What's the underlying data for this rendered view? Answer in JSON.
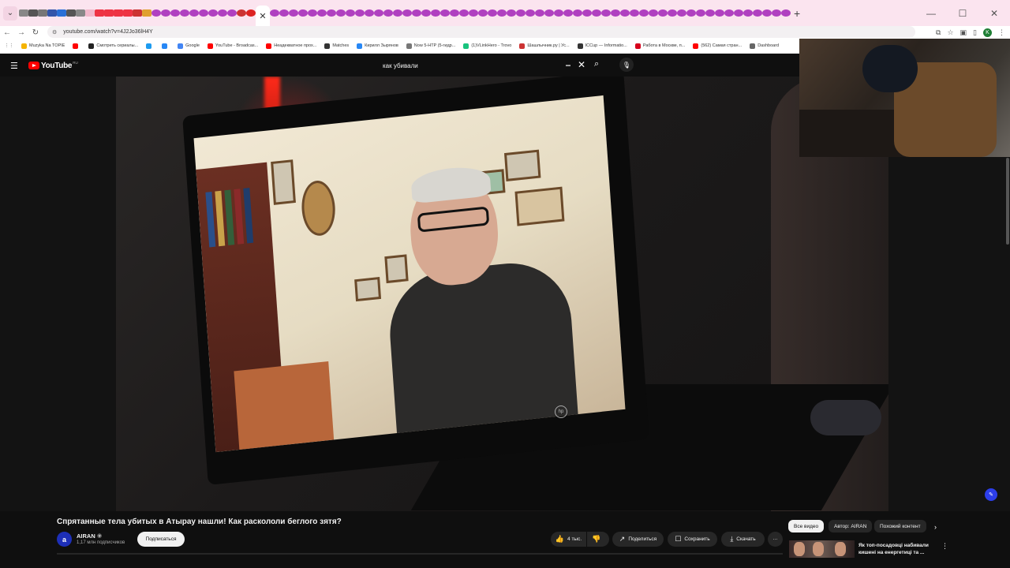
{
  "browser": {
    "url": "youtube.com/watch?v=4J2Jo36lH4Y",
    "window_controls": [
      "—",
      "☐",
      "✕"
    ]
  },
  "tab_colors": [
    "#888",
    "#555",
    "#777",
    "#3355aa",
    "#2a6fd6",
    "#555",
    "#888",
    "#f2b8cc",
    "#e34",
    "#e34",
    "#e34",
    "#e34",
    "#c33",
    "#e0a030",
    "#b040c0",
    "#b040c0",
    "#b040c0",
    "#b040c0",
    "#b040c0",
    "#b040c0",
    "#b040c0",
    "#b040c0",
    "#b040c0",
    "#c33",
    "#d22"
  ],
  "bookmarks": [
    {
      "label": "Muzyka Na TOPIE",
      "color": "#f5b400"
    },
    {
      "label": "",
      "color": "#ff0000"
    },
    {
      "label": "Смотреть сериалы...",
      "color": "#222"
    },
    {
      "label": "",
      "color": "#1d9bf0"
    },
    {
      "label": "",
      "color": "#2787f5"
    },
    {
      "label": "Google",
      "color": "#4285f4"
    },
    {
      "label": "YouTube - Broadcas...",
      "color": "#ff0000"
    },
    {
      "label": "Неадекватное прох...",
      "color": "#ff0000"
    },
    {
      "label": "Matches",
      "color": "#333"
    },
    {
      "label": "Кирилл Зырянов",
      "color": "#2787f5"
    },
    {
      "label": "Now 5-HTP (5-гидр...",
      "color": "#777"
    },
    {
      "label": "(1)VLinkHero - Trovo",
      "color": "#19c37d"
    },
    {
      "label": "Шашлычник.ру | Ус...",
      "color": "#c33"
    },
    {
      "label": "ICCup — Informatio...",
      "color": "#333"
    },
    {
      "label": "Работа в Москве, п...",
      "color": "#d6001c"
    },
    {
      "label": "(562) Самая стран...",
      "color": "#ff0000"
    },
    {
      "label": "Dashboard",
      "color": "#666"
    }
  ],
  "youtube": {
    "logo_text": "YouTube",
    "region": "RU",
    "search_query": "как убивали",
    "video": {
      "title": "Спрятанные тела убитых в Атырау нашли! Как раскололи беглого зятя?",
      "channel": "AIRAN",
      "subscribers": "1,17 млн подписчиков",
      "subscribe_label": "Подписаться",
      "likes": "4 тыс.",
      "share_label": "Поделиться",
      "save_label": "Сохранить",
      "download_label": "Скачать",
      "more_label": "···"
    },
    "chips": [
      "Все видео",
      "Автор: AIRAN",
      "Похожий контент"
    ],
    "recommendation": {
      "title": "Як топ-посадовці набивали кишені на енергетиці та ..."
    },
    "hp_text": "hp"
  }
}
